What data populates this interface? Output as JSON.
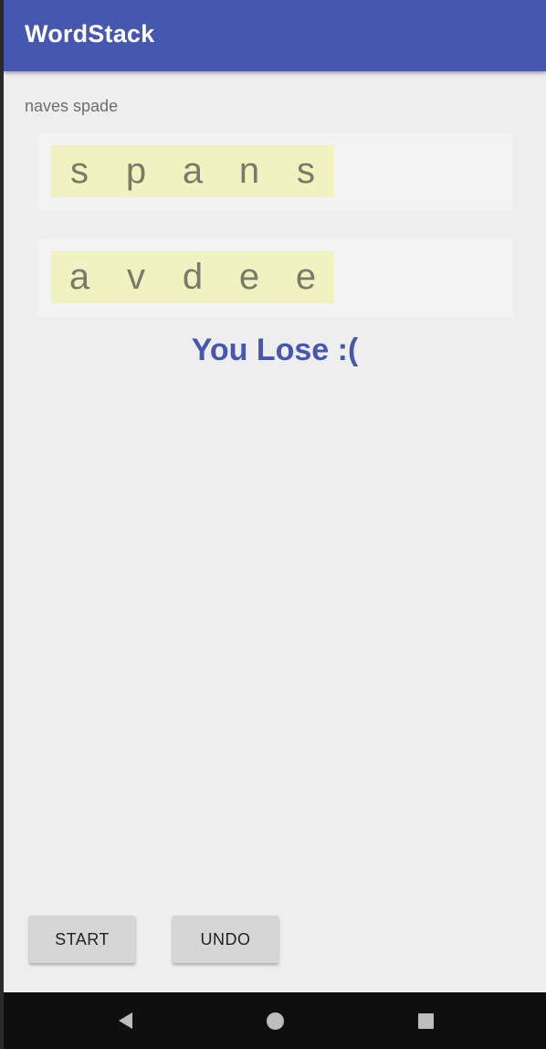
{
  "app": {
    "title": "WordStack"
  },
  "hint": "naves spade",
  "stacks": [
    {
      "letters": [
        "s",
        "p",
        "a",
        "n",
        "s"
      ]
    },
    {
      "letters": [
        "a",
        "v",
        "d",
        "e",
        "e"
      ]
    }
  ],
  "result": "You Lose :(",
  "buttons": {
    "start": "START",
    "undo": "UNDO"
  },
  "navbar": {
    "icons": [
      "back-icon",
      "home-icon",
      "recents-icon"
    ]
  },
  "colors": {
    "primary": "#4557b0",
    "tile_bg": "#f0f3bf",
    "stack_bg": "#f3f3f3"
  }
}
